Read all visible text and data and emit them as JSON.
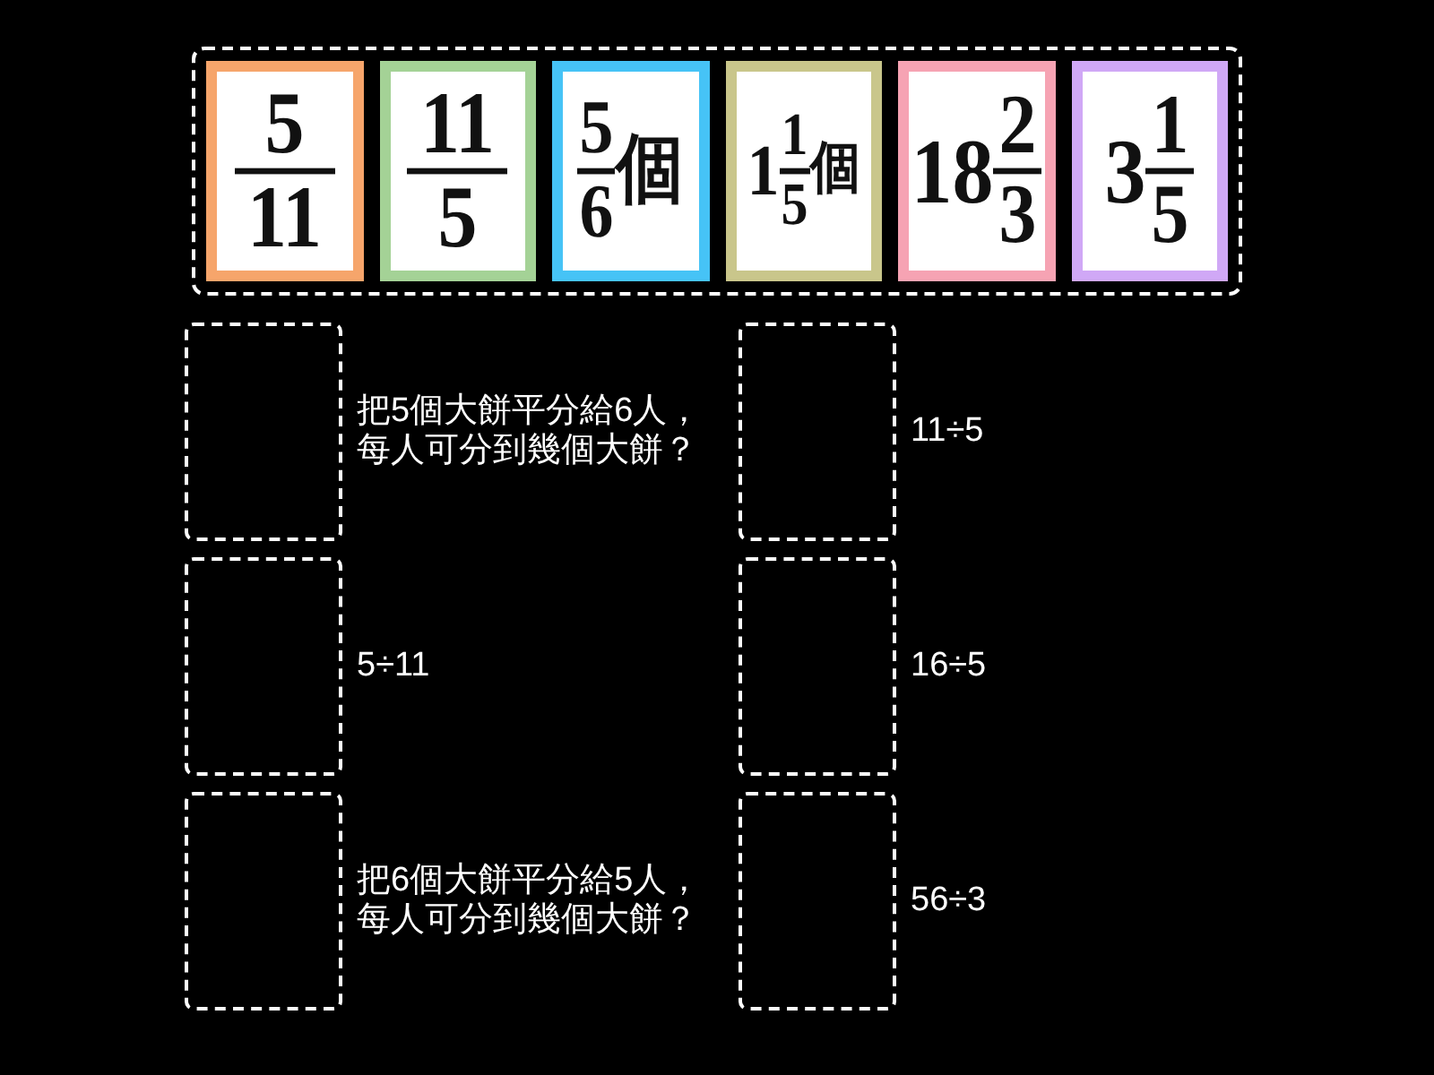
{
  "cards": [
    {
      "kind": "fraction",
      "numerator": "5",
      "denominator": "11",
      "color": "#f6a56b"
    },
    {
      "kind": "fraction",
      "numerator": "11",
      "denominator": "5",
      "color": "#a4d296"
    },
    {
      "kind": "fraction",
      "numerator": "5",
      "denominator": "6",
      "unit": "個",
      "color": "#46c3f6"
    },
    {
      "kind": "mixed",
      "whole": "1",
      "numerator": "1",
      "denominator": "5",
      "unit": "個",
      "color": "#c9c68b"
    },
    {
      "kind": "mixed",
      "whole": "18",
      "numerator": "2",
      "denominator": "3",
      "color": "#f6a3b3"
    },
    {
      "kind": "mixed",
      "whole": "3",
      "numerator": "1",
      "denominator": "5",
      "color": "#d0a8f6"
    }
  ],
  "targets": [
    {
      "prompt": "把5個大餅平分給6人，每人可分到幾個大餅？"
    },
    {
      "prompt": "11÷5"
    },
    {
      "prompt": "5÷11"
    },
    {
      "prompt": "16÷5"
    },
    {
      "prompt": "把6個大餅平分給5人，每人可分到幾個大餅？"
    },
    {
      "prompt": "56÷3"
    }
  ]
}
